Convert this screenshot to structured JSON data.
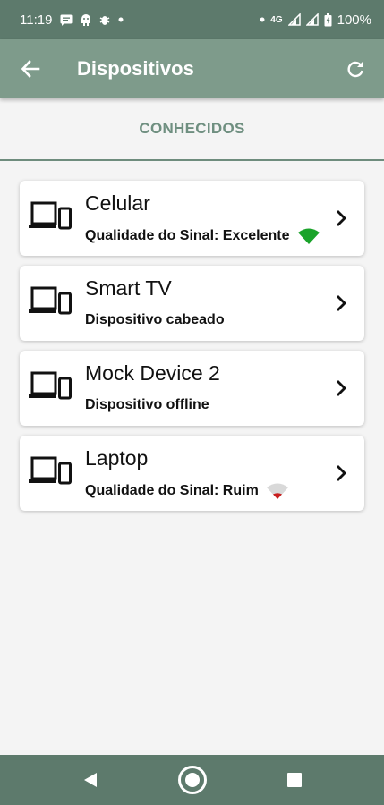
{
  "status_bar": {
    "time": "11:19",
    "network_type": "4G",
    "battery_percent": "100%",
    "icons": [
      "message-icon",
      "android-icon",
      "bug-icon",
      "dot-icon",
      "dot-icon",
      "signal-icon",
      "signal-icon",
      "battery-icon"
    ]
  },
  "app_bar": {
    "title": "Dispositivos",
    "back_icon": "arrow-left-icon",
    "refresh_icon": "refresh-icon"
  },
  "section": {
    "label": "CONHECIDOS"
  },
  "devices": [
    {
      "name": "Celular",
      "detail": "Qualidade do Sinal: Excelente",
      "signal": "excellent",
      "signal_color": "#1aa32a",
      "icon": "devices-icon"
    },
    {
      "name": "Smart TV",
      "detail": "Dispositivo cabeado",
      "signal": "none",
      "icon": "devices-icon"
    },
    {
      "name": "Mock Device 2",
      "detail": "Dispositivo offline",
      "signal": "none",
      "icon": "devices-icon"
    },
    {
      "name": "Laptop",
      "detail": "Qualidade do Sinal: Ruim",
      "signal": "poor",
      "signal_color": "#c81e1e",
      "icon": "devices-icon"
    }
  ],
  "colors": {
    "status_bar": "#5d7a6c",
    "app_bar": "#7e9b8b",
    "accent": "#6f8f80",
    "background": "#f4f4f4"
  }
}
